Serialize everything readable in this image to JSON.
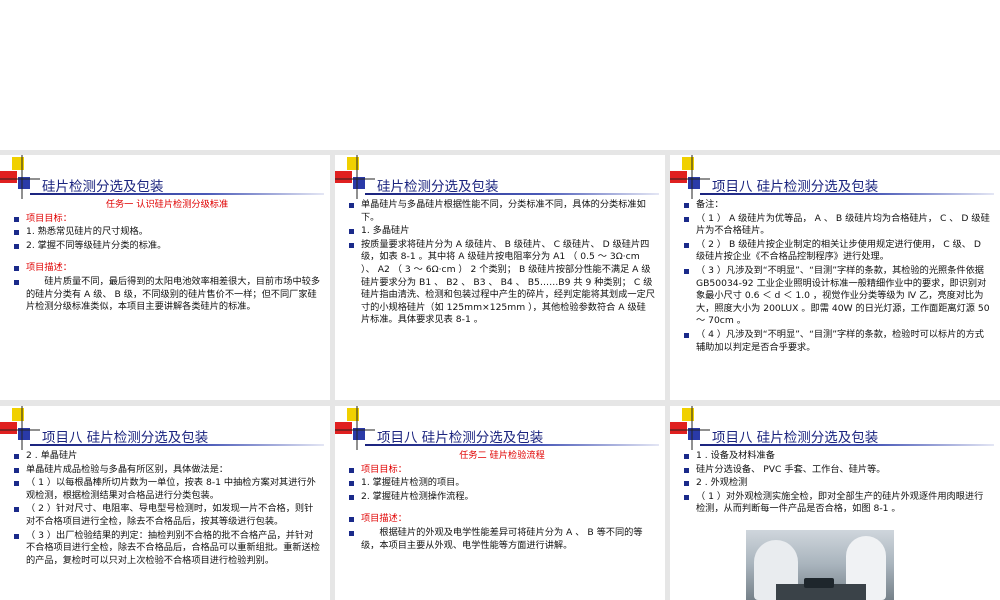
{
  "slides": [
    {
      "title": "硅片检测分选及包装",
      "lines": [
        {
          "t": "任务一  认识硅片检测分级标准",
          "cls": "red center"
        },
        {
          "t": "项目目标：",
          "cls": "red",
          "b": 1
        },
        {
          "t": "1. 熟悉常见硅片的尺寸规格。",
          "b": 1
        },
        {
          "t": "2. 掌握不同等级硅片分类的标准。",
          "b": 1
        },
        {
          "t": "",
          "cls": "gap"
        },
        {
          "t": "项目描述：",
          "cls": "red",
          "b": 1
        },
        {
          "t": "硅片质量不同，最后得到的太阳电池效率相差很大，目前市场中较多的硅片分类有 A 级、 B 级，不同级别的硅片售价不一样；但不同厂家硅片检测分级标准类似，本项目主要讲解各类硅片的标准。",
          "cls": "indent",
          "b": 1
        }
      ]
    },
    {
      "title": "硅片检测分选及包装",
      "lines": [
        {
          "t": "单晶硅片与多晶硅片根据性能不同，分类标准不同，具体的分类标准如下。",
          "b": 1
        },
        {
          "t": "1. 多晶硅片",
          "b": 1
        },
        {
          "t": "按质量要求将硅片分为 A 级硅片、 B 级硅片、 C 级硅片、 D 级硅片四级，如表 8-1 。其中将 A 级硅片按电阻率分为 A1 （ 0.5 ～ 3Ω·cm ）、 A2 （ 3 ～ 6Ω·cm ） 2 个类别； B 级硅片按部分性能不满足 A 级硅片要求分为 B1 、 B2 、 B3 、 B4 、 B5……B9 共 9 种类别； C 级硅片指由清洗、检测和包装过程中产生的碎片，经判定能将其划成一定尺寸的小规格硅片（如 125mm×125mm ），其他检验参数符合 A 级硅片标准。具体要求见表 8-1 。",
          "b": 1
        }
      ]
    },
    {
      "title": "项目八  硅片检测分选及包装",
      "lines": [
        {
          "t": "备注：",
          "b": 1
        },
        {
          "t": "（ 1 ） A 级硅片为优等品， A 、 B 级硅片均为合格硅片， C 、 D 级硅片为不合格硅片。",
          "b": 1
        },
        {
          "t": "（ 2 ） B 级硅片按企业制定的相关让步使用规定进行使用， C 级、 D 级硅片按企业《不合格品控制程序》进行处理。",
          "b": 1
        },
        {
          "t": "（ 3 ）凡涉及到“不明显”、“目测”字样的条款，其检验的光照条件依据 GB50034-92 工业企业照明设计标准一般精细作业中的要求，即识别对象最小尺寸 0.6 ＜ d ＜ 1.0 ，视觉作业分类等级为 Ⅳ 乙，亮度对比为大，照度大小为 200LUX 。即需 40W 的日光灯源，工作面距离灯源 50 ～ 70cm 。",
          "b": 1
        },
        {
          "t": "（ 4 ）凡涉及到“不明显”、“目测”字样的条款，检验时可以标片的方式辅助加以判定是否合乎要求。",
          "b": 1
        }
      ]
    },
    {
      "title": "项目八  硅片检测分选及包装",
      "lines": [
        {
          "t": "2 . 单晶硅片",
          "b": 1
        },
        {
          "t": "单晶硅片成品检验与多晶有所区别，具体做法是：",
          "b": 1
        },
        {
          "t": "（ 1 ）以每根晶棒所切片数为一单位，按表 8-1 中抽检方案对其进行外观检测，根据检测结果对合格品进行分类包装。",
          "b": 1
        },
        {
          "t": "（ 2 ）针对尺寸、电阻率、导电型号检测时，如发现一片不合格，则针对不合格项目进行全检，除去不合格品后，按其等级进行包装。",
          "b": 1
        },
        {
          "t": "（ 3 ）出厂检验结果的判定：抽检判别不合格的批不合格产品，并针对不合格项目进行全检，除去不合格品后，合格品可以重新组批。重新送检的产品，复检时可以只对上次检验不合格项目进行检验判别。",
          "b": 1
        }
      ]
    },
    {
      "title": "项目八  硅片检测分选及包装",
      "lines": [
        {
          "t": "任务二  硅片检验流程",
          "cls": "red center"
        },
        {
          "t": "项目目标：",
          "cls": "red",
          "b": 1
        },
        {
          "t": "1. 掌握硅片检测的项目。",
          "b": 1
        },
        {
          "t": "2. 掌握硅片检测操作流程。",
          "b": 1
        },
        {
          "t": "",
          "cls": "gap"
        },
        {
          "t": "项目描述：",
          "cls": "red",
          "b": 1
        },
        {
          "t": "根据硅片的外观及电学性能差异可将硅片分为 A 、 B 等不同的等级，本项目主要从外观、电学性能等方面进行讲解。",
          "cls": "indent",
          "b": 1
        }
      ]
    },
    {
      "title": "项目八  硅片检测分选及包装",
      "lines": [
        {
          "t": "1 . 设备及材料准备",
          "b": 1
        },
        {
          "t": "硅片分选设备、 PVC 手套、工作台、硅片等。",
          "b": 1
        },
        {
          "t": "2 . 外观检测",
          "b": 1
        },
        {
          "t": "（ 1 ）对外观检测实施全检，即对全部生产的硅片外观逐件用肉眼进行检测，从而判断每一件产品是否合格，如图 8-1 。",
          "b": 1
        }
      ]
    }
  ]
}
